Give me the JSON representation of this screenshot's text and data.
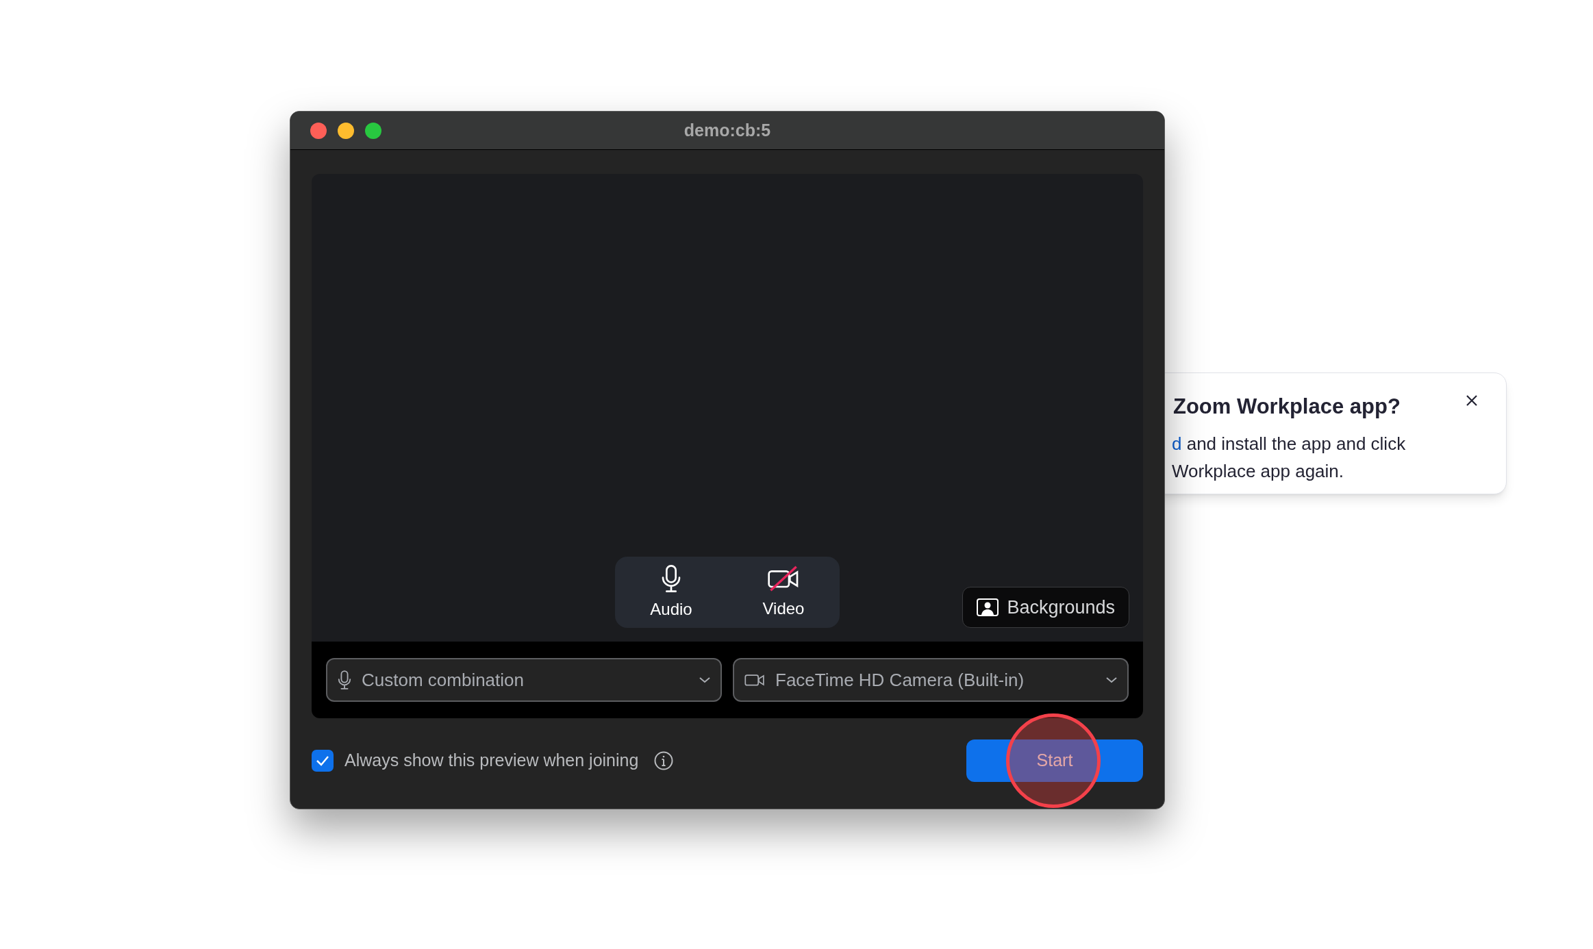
{
  "window": {
    "title": "demo:cb:5"
  },
  "preview_controls": [
    {
      "kind": "audio",
      "label": "Audio",
      "off": false
    },
    {
      "kind": "video",
      "label": "Video",
      "off": true
    }
  ],
  "backgrounds_button": {
    "label": "Backgrounds"
  },
  "devices": [
    {
      "kind": "microphone",
      "value": "Custom combination"
    },
    {
      "kind": "camera",
      "value": "FaceTime HD Camera (Built-in)"
    }
  ],
  "preview_option": {
    "label": "Always show this preview when joining",
    "checked": true
  },
  "start_button": {
    "label": "Start",
    "highlighted": true
  },
  "popup": {
    "title": "Zoom Workplace app?",
    "link": "d",
    "line_1": "and install the app and click",
    "line_2": "Workplace app again."
  }
}
